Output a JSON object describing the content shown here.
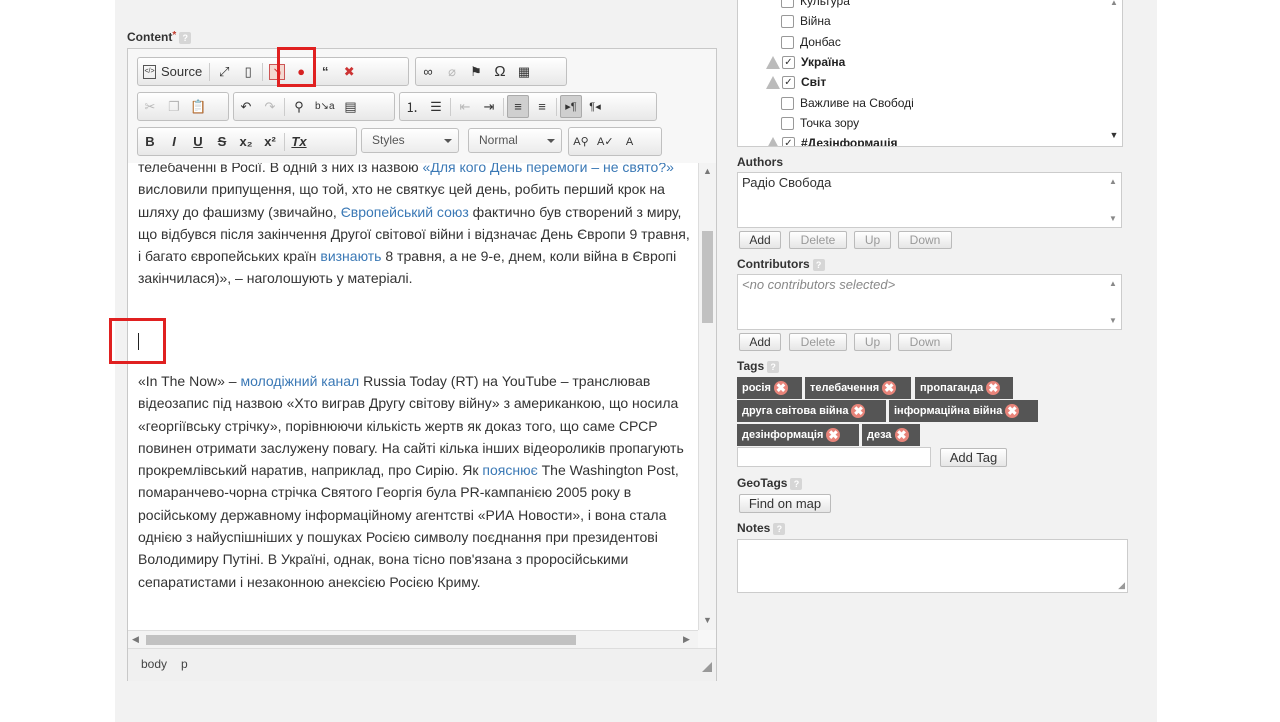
{
  "content_label": "Content",
  "content_required": "*",
  "toolbar": {
    "source": "Source",
    "styles": "Styles",
    "format": "Normal",
    "icons": {
      "source": "source-icon",
      "maximize": "maximize-icon",
      "showblocks": "show-blocks-icon",
      "insert_snippet": "insert-snippet-icon",
      "map_pin": "map-pin-icon",
      "quote": "quote-icon",
      "remove_embed": "remove-embed-icon",
      "link": "link-icon",
      "unlink": "unlink-icon",
      "anchor": "flag-icon",
      "special_char": "omega-icon",
      "table": "table-icon"
    },
    "row2": {
      "find": "find-icon",
      "replace": "replace-icon",
      "select_all": "select-all-icon"
    },
    "row3": {
      "bold": "B",
      "italic": "I",
      "underline": "U",
      "strike": "S",
      "sub": "x₂",
      "sup": "x²",
      "clear": "Tx"
    }
  },
  "editor_text": {
    "p1_top": "телебаченні в Росії. В одній з них із назвою ",
    "p1_link1": "«Для кого День перемоги – не свято?»",
    "p1_a": " висловили припущення, що той, хто не святкує цей день, робить перший крок на шляху до фашизму (звичайно, ",
    "p1_link2": "Європейський союз",
    "p1_b": " фактично був створений з миру, що відбувся після закінчення Другої світової війни і відзначає День Європи 9 травня, і багато європейських країн ",
    "p1_link3": "визнають",
    "p1_c": " 8 травня, а не 9-е, днем, коли війна в Європі закінчилася)», – наголошують у матеріалі.",
    "p2_a": "«In The Now» – ",
    "p2_link1": "молодіжний канал",
    "p2_b": " Russia Today (RT) на YouTube – транслював відеозапис під назвою «Хто виграв Другу світову війну» з американкою, що носила «георгіївську стрічку», порівнюючи кількість жертв як доказ того, що саме СРСР повинен отримати заслужену повагу. На сайті кілька інших відеороликів пропагують прокремлівський наратив, наприклад, про Сирію. Як ",
    "p2_link2": "пояснює",
    "p2_c": " The Washington Post, помаранчево-чорна стрічка Святого Георгія була PR-кампанією 2005 року в російському державному інформаційному агентстві «РИА Новости», і вона стала однією з найуспішніших у пошуках Росією символу поєднання при президентові Володимиру Путіні. В Україні, однак, вона тісно пов'язана з проросійськими сепаратистами і незаконною анексією Росією Криму."
  },
  "pathbar": {
    "body": "body",
    "p": "p"
  },
  "categories": [
    {
      "label": "Культура",
      "checked": false,
      "warn": false
    },
    {
      "label": "Війна",
      "checked": false,
      "warn": false
    },
    {
      "label": "Донбас",
      "checked": false,
      "warn": false
    },
    {
      "label": "Україна",
      "checked": true,
      "warn": true
    },
    {
      "label": "Світ",
      "checked": true,
      "warn": true
    },
    {
      "label": "Важливе на Свободі",
      "checked": false,
      "warn": false
    },
    {
      "label": "Точка зору",
      "checked": false,
      "warn": false
    },
    {
      "label": "#Дезінформація",
      "checked": true,
      "warn": true
    }
  ],
  "authors": {
    "label": "Authors",
    "value": "Радіо Свобода"
  },
  "contributors": {
    "label": "Contributors",
    "placeholder": "<no contributors selected>"
  },
  "list_buttons": {
    "add": "Add",
    "delete": "Delete",
    "up": "Up",
    "down": "Down"
  },
  "tags": {
    "label": "Tags",
    "items": [
      "росія",
      "телебачення",
      "пропаганда",
      "друга світова війна",
      "інформаційна війна",
      "дезінформація",
      "деза"
    ],
    "add_button": "Add Tag"
  },
  "geotags": {
    "label": "GeoTags",
    "button": "Find on map"
  },
  "notes": {
    "label": "Notes"
  }
}
